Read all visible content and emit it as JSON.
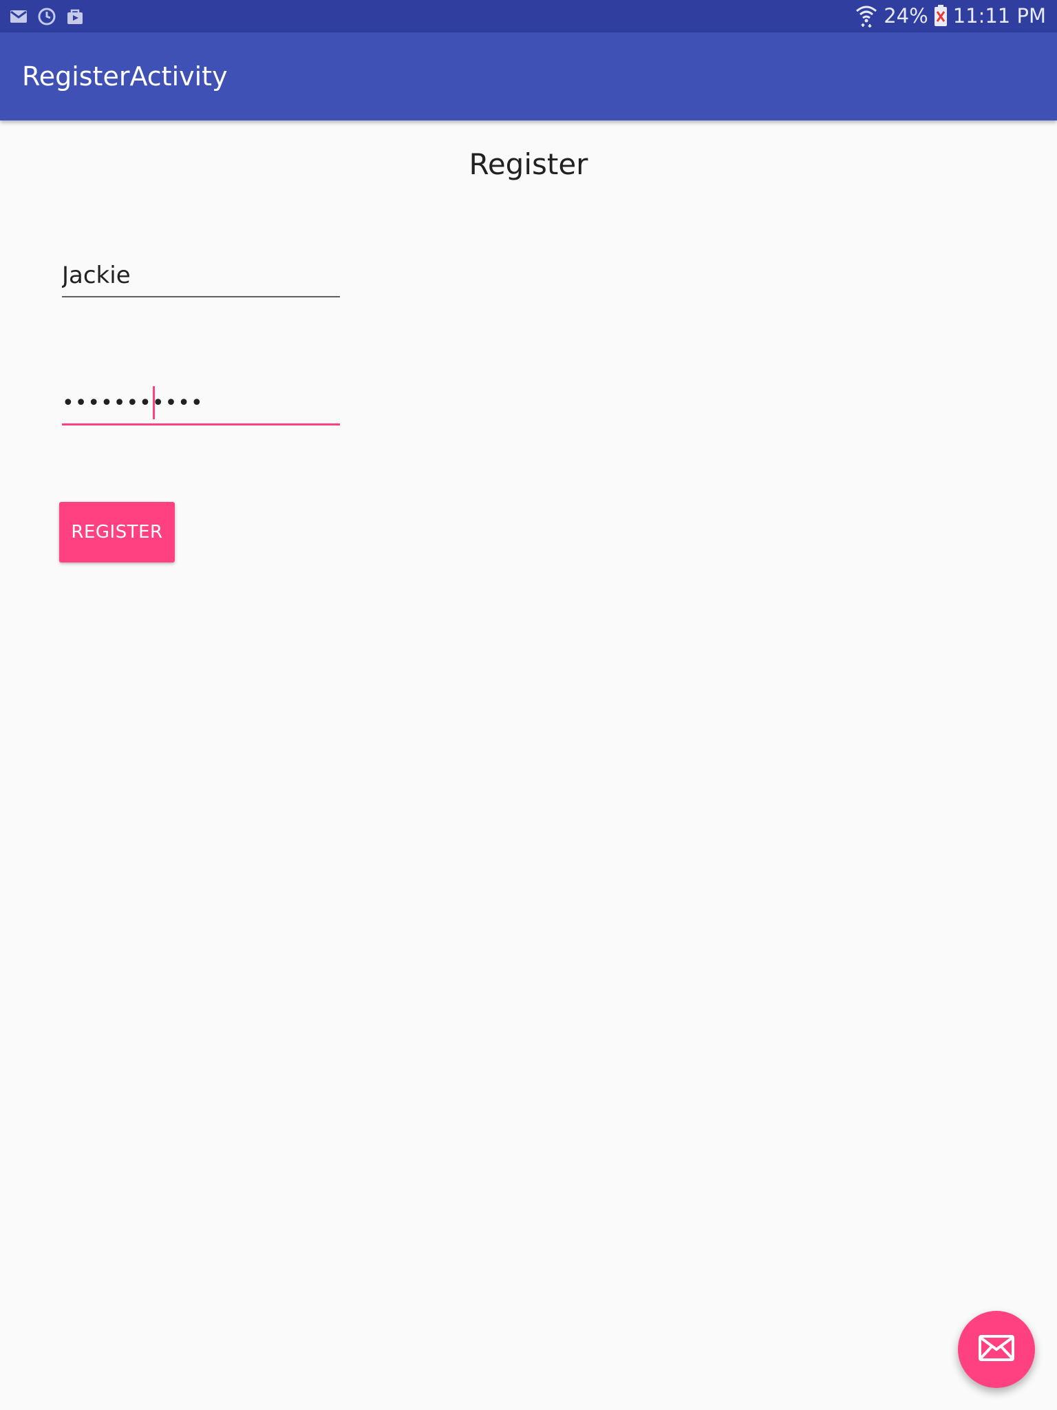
{
  "status_bar": {
    "icons_left": [
      "gmail-icon",
      "sync-icon",
      "store-bag-icon"
    ],
    "wifi_icon": "wifi-icon",
    "battery_percent": "24%",
    "battery_icon": "battery-alert-icon",
    "time": "11:11 PM"
  },
  "app_bar": {
    "title": "RegisterActivity"
  },
  "page": {
    "heading": "Register"
  },
  "form": {
    "username_value": "Jackie",
    "password_value": "•••••••••••",
    "register_label": "REGISTER"
  },
  "fab": {
    "icon": "email-icon"
  },
  "colors": {
    "status_bar": "#303f9f",
    "app_bar": "#3f51b5",
    "accent": "#ff4081",
    "background": "#fafafa"
  }
}
